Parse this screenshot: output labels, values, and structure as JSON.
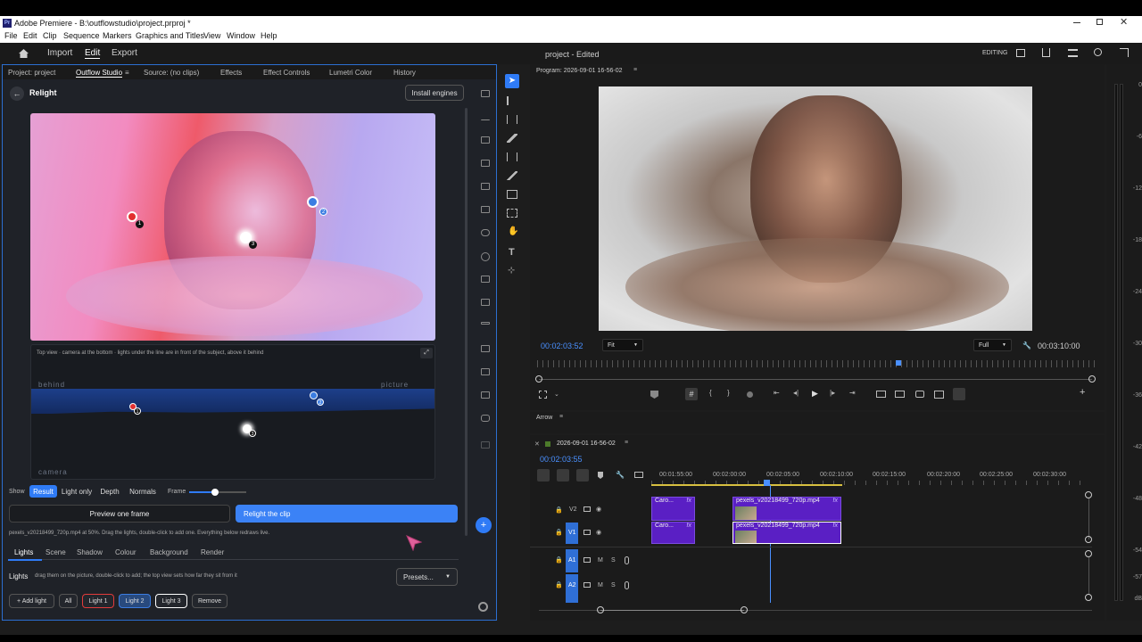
{
  "window": {
    "title": "Adobe Premiere - B:\\outflowstudio\\project.prproj *",
    "app_badge": "Pr"
  },
  "menu": [
    "File",
    "Edit",
    "Clip",
    "Sequence",
    "Markers",
    "Graphics and Titles",
    "View",
    "Window",
    "Help"
  ],
  "workspace": {
    "tabs": [
      "Import",
      "Edit",
      "Export"
    ],
    "active": "Edit",
    "project_title": "project - Edited",
    "mode_label": "EDITING"
  },
  "left_panel": {
    "tabs": [
      "Project: project",
      "Outflow Studio",
      "Source: (no clips)",
      "Effects",
      "Effect Controls",
      "Lumetri Color",
      "History"
    ],
    "active_tab": "Outflow Studio",
    "header_title": "Relight",
    "install_engines": "Install engines",
    "topview_caption": "Top view · camera at the bottom · lights under the line are in front of the subject, above it behind",
    "topview_labels": {
      "behind": "behind",
      "picture": "picture",
      "camera": "camera"
    },
    "light_markers": [
      "1",
      "2",
      "3"
    ],
    "show_label": "Show",
    "show_options": [
      "Result",
      "Light only",
      "Depth",
      "Normals"
    ],
    "show_active": "Result",
    "frame_label": "Frame",
    "frame_slider_value": 0.45,
    "preview_button": "Preview one frame",
    "relight_button": "Relight the clip",
    "status_text": "pexels_v20218499_720p.mp4 at 50%. Drag the lights, double-click to add one. Everything below redraws live.",
    "sub_tabs": [
      "Lights",
      "Scene",
      "Shadow",
      "Colour",
      "Background",
      "Render"
    ],
    "active_sub_tab": "Lights",
    "lights_heading": "Lights",
    "lights_hint": "drag them on the picture, double-click to add; the top view sets how far they sit from it",
    "presets_label": "Presets...",
    "light_buttons": [
      "+ Add light",
      "All",
      "Light 1",
      "Light 2",
      "Light 3",
      "Remove"
    ],
    "light_button_colors": {
      "Light 1": "#e23b3b",
      "Light 2": "#3b7de2",
      "Light 3": "#ffffff"
    }
  },
  "program_monitor": {
    "title": "Program: 2026-09-01 16-56-02",
    "timecode_current": "00:02:03:52",
    "fit_label": "Fit",
    "quality_label": "Full",
    "timecode_duration": "00:03:10:00"
  },
  "tools": {
    "label": "Arrow"
  },
  "timeline": {
    "sequence_name": "2026-09-01 16-56-02",
    "timecode": "00:02:03:55",
    "ruler": [
      "00:01:55:00",
      "00:02:00:00",
      "00:02:05:00",
      "00:02:10:00",
      "00:02:15:00",
      "00:02:20:00",
      "00:02:25:00",
      "00:02:30:00"
    ],
    "tracks": [
      "V2",
      "V1",
      "A1",
      "A2"
    ],
    "clips": [
      {
        "name": "Caro...",
        "track": "V2",
        "fx": "fx"
      },
      {
        "name": "pexels_v20218499_720p.mp4",
        "track": "V2",
        "fx": "fx"
      },
      {
        "name": "Caro...",
        "track": "V1",
        "fx": "fx"
      },
      {
        "name": "pexels_v20218499_720p.mp4",
        "track": "V1",
        "fx": "fx"
      }
    ],
    "track_buttons": [
      "M",
      "S"
    ]
  },
  "audio_meter": {
    "marks": [
      "0",
      "-6",
      "-12",
      "-18",
      "-24",
      "-30",
      "-36",
      "-42",
      "-48",
      "-54",
      "-57"
    ],
    "unit": "dB"
  },
  "colors": {
    "accent": "#2f7bf6",
    "clip_purple": "#5a1fc4",
    "panel_border": "#2c6fd1"
  }
}
